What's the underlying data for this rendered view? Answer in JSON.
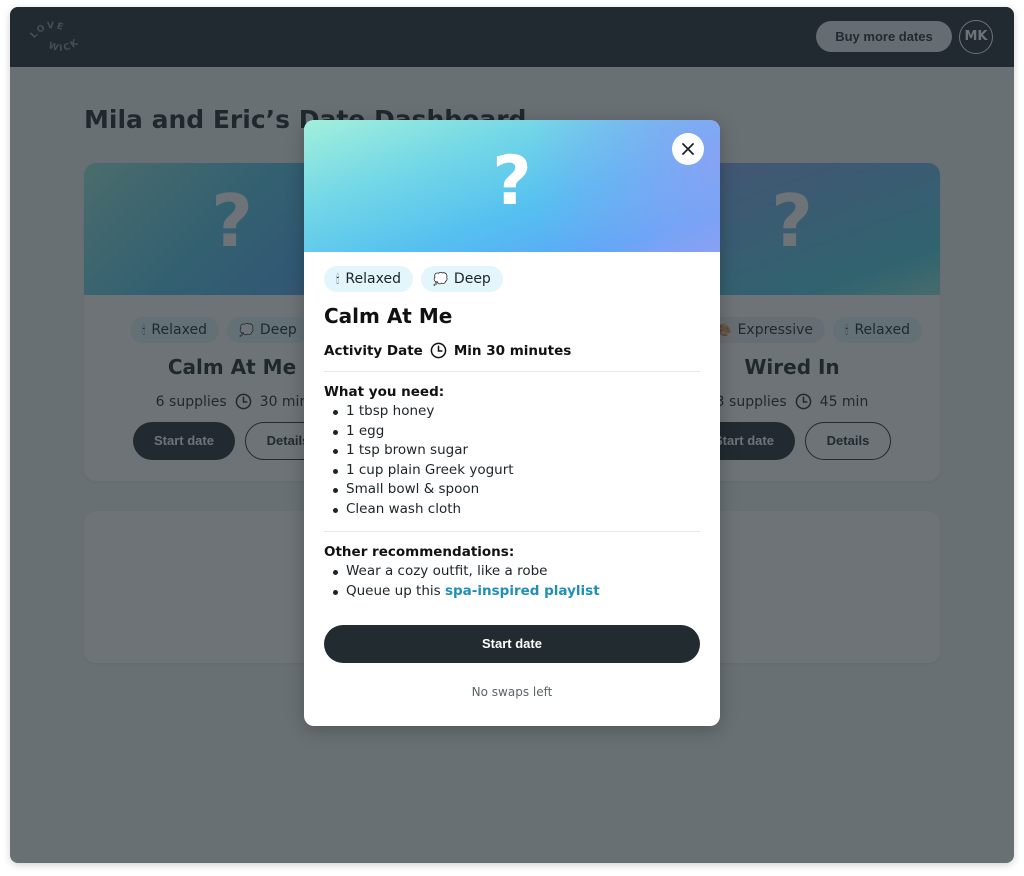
{
  "app": {
    "logo_text_top": "LOVE",
    "logo_text_bottom": "WICK",
    "buy_more_label": "Buy more dates",
    "avatar_initials": "MK"
  },
  "page": {
    "title": "Mila and Eric’s Date Dashboard"
  },
  "cards": [
    {
      "hero_symbol": "?",
      "tags": [
        {
          "icon": "candle-icon",
          "glyph": "🕯",
          "label": "Relaxed"
        },
        {
          "icon": "thought-bubble-icon",
          "glyph": "💭",
          "label": "Deep"
        }
      ],
      "name": "Calm At Me",
      "supplies": "6 supplies",
      "duration": "30 min",
      "start_label": "Start date",
      "details_label": "Details"
    },
    {
      "hero_symbol": "?",
      "tags": [
        {
          "icon": "expressive-icon",
          "glyph": "🎨",
          "label": "Expressive"
        },
        {
          "icon": "candle-icon",
          "glyph": "🕯",
          "label": "Relaxed"
        }
      ],
      "name": "Wired In",
      "supplies": "3 supplies",
      "duration": "45 min",
      "start_label": "Start date",
      "details_label": "Details"
    }
  ],
  "modal": {
    "hero_symbol": "?",
    "close_icon": "close-icon",
    "tags": [
      {
        "icon": "candle-icon",
        "glyph": "🕯",
        "label": "Relaxed"
      },
      {
        "icon": "thought-bubble-icon",
        "glyph": "💭",
        "label": "Deep"
      }
    ],
    "title": "Calm At Me",
    "type_label": "Activity Date",
    "duration": "Min 30 minutes",
    "needs_heading": "What you need:",
    "needs": [
      "1 tbsp honey",
      "1 egg",
      "1 tsp brown sugar",
      "1 cup plain Greek yogurt",
      "Small bowl & spoon",
      "Clean wash cloth"
    ],
    "recs_heading": "Other recommendations:",
    "recs": [
      {
        "text": "Wear a cozy outfit, like a robe"
      },
      {
        "text": "Queue up this ",
        "link": "spa-inspired playlist"
      }
    ],
    "start_label": "Start date",
    "swaps_text": "No swaps left"
  },
  "colors": {
    "dark": "#222b30",
    "tag_bg": "#e2f6fb",
    "link": "#1f8fb8",
    "overlay": "rgba(34,43,48,0.66)"
  }
}
